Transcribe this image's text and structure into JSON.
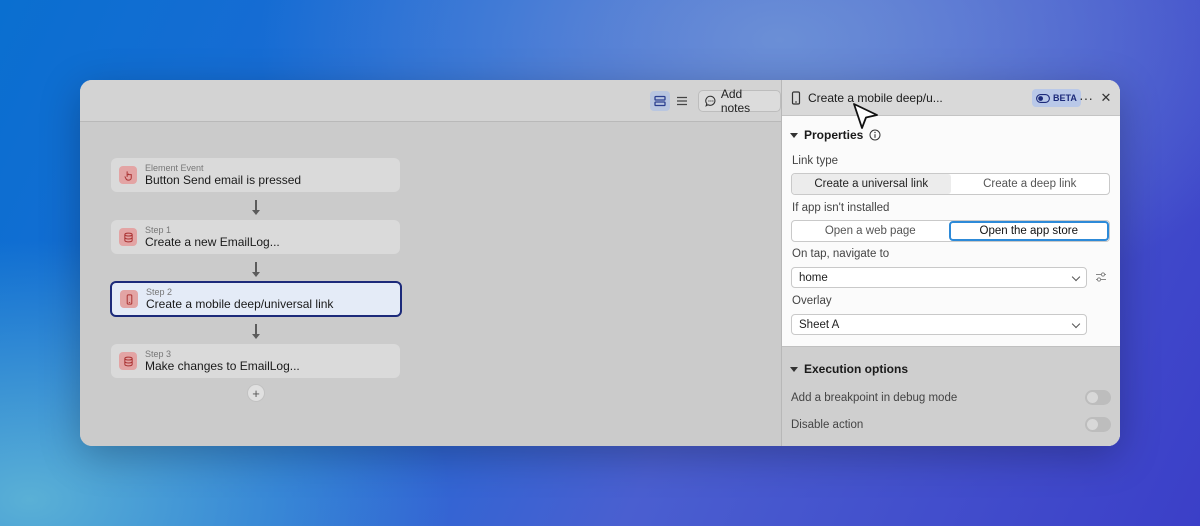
{
  "toolbar": {
    "add_notes_label": "Add notes"
  },
  "workflow": {
    "trigger": {
      "kicker": "Element Event",
      "title": "Button Send email is pressed"
    },
    "steps": [
      {
        "kicker": "Step 1",
        "title": "Create a new EmailLog..."
      },
      {
        "kicker": "Step 2",
        "title": "Create a mobile deep/universal link"
      },
      {
        "kicker": "Step 3",
        "title": "Make changes to EmailLog..."
      }
    ],
    "add_step_label": "+"
  },
  "panel": {
    "title": "Create a mobile deep/u...",
    "beta_label": "BETA",
    "more_label": "···",
    "close_label": "✕",
    "properties": {
      "heading": "Properties",
      "link_type_label": "Link type",
      "link_type_options": [
        "Create a universal link",
        "Create a deep link"
      ],
      "not_installed_label": "If app isn't installed",
      "not_installed_options": [
        "Open a web page",
        "Open the app store"
      ],
      "navigate_label": "On tap, navigate to",
      "navigate_value": "home",
      "overlay_label": "Overlay",
      "overlay_value": "Sheet A"
    },
    "execution": {
      "heading": "Execution options",
      "breakpoint_label": "Add a breakpoint in debug mode",
      "disable_label": "Disable action"
    }
  },
  "colors": {
    "selected_border": "#1c2a7a",
    "accent_blue": "#2d8ad8",
    "step_icon_bg": "#e3a4a4"
  }
}
